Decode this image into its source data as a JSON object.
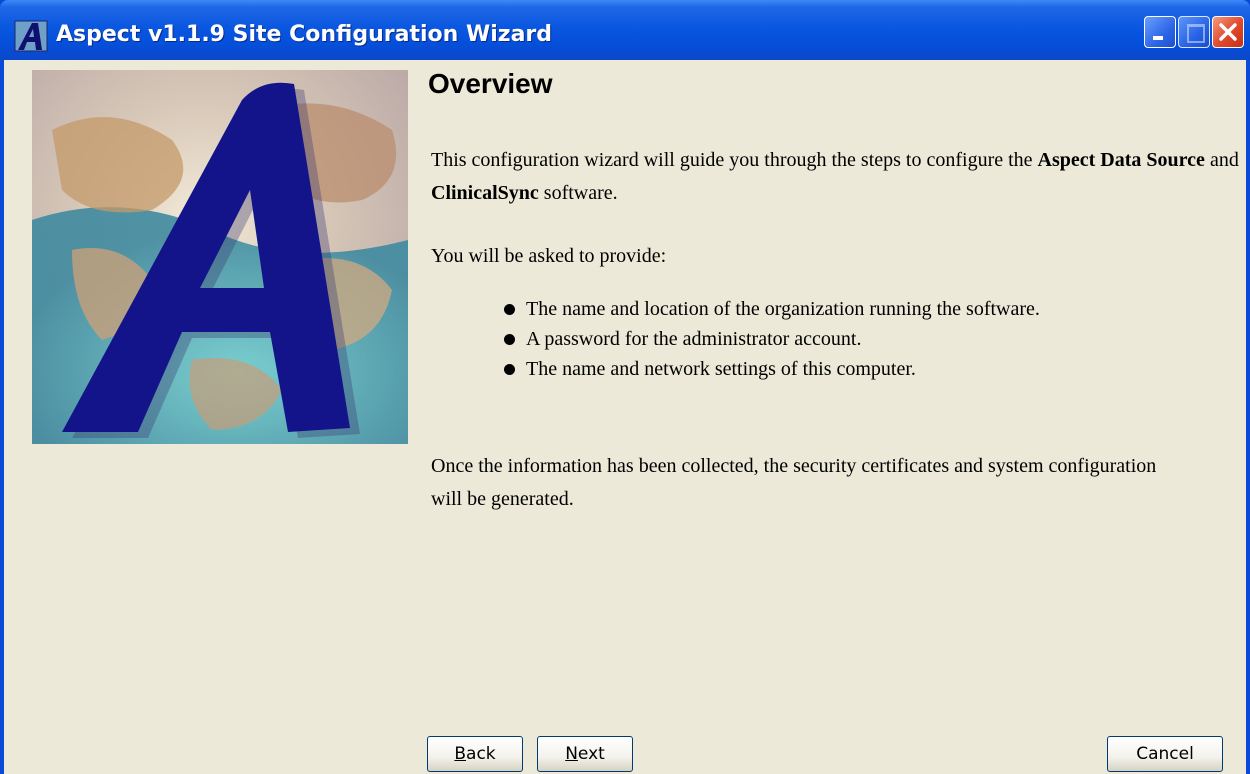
{
  "window": {
    "title": "Aspect v1.1.9 Site Configuration Wizard"
  },
  "page": {
    "heading": "Overview",
    "intro_before": "This configuration wizard will guide you through the steps to configure the ",
    "product_one": "Aspect Data Source",
    "intro_mid": " and ",
    "product_two": "ClinicalSync",
    "intro_after": " software.",
    "prompt": "You will be asked to provide:",
    "requirements": [
      "The name and location of the organization running the software.",
      "A password for the administrator account.",
      "The name and network settings of this computer."
    ],
    "outro": "Once the information has been collected, the security certificates and system configuration will be generated."
  },
  "buttons": {
    "back_letter": "B",
    "back_rest": "ack",
    "next_letter": "N",
    "next_rest": "ext",
    "cancel": "Cancel"
  },
  "icons": {
    "app": "aspect-logo-icon",
    "minimize": "minimize-icon",
    "maximize": "maximize-icon",
    "close": "close-icon"
  },
  "colors": {
    "titlebar": "#0a57e0",
    "client_background": "#ece9d8",
    "close_button": "#e0472b",
    "logo_letter": "#14148a"
  }
}
